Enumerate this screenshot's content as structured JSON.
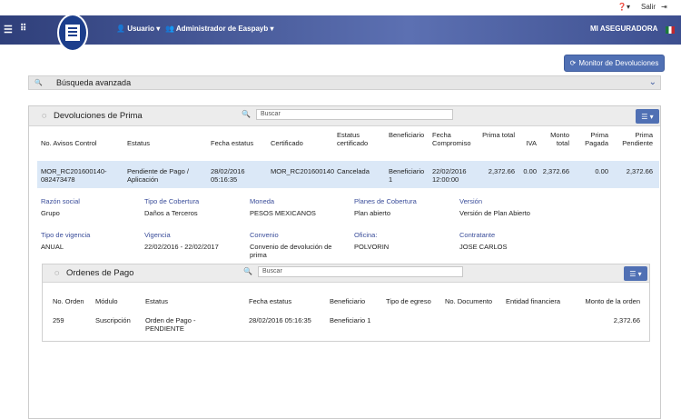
{
  "topbar": {
    "help_icon": "question-icon",
    "salir": "Salir"
  },
  "nav": {
    "usuario": "Usuario",
    "admin": "Administrador de Easpayb",
    "company": "MI ASEGURADORA"
  },
  "monitor_button": "Monitor de Devoluciones",
  "busqueda": "Búsqueda avanzada",
  "panel": {
    "title": "Devoluciones de Prima",
    "search_placeholder": "Buscar"
  },
  "table": {
    "headers": [
      "No. Avisos Control",
      "Estatus",
      "Fecha estatus",
      "Certificado",
      "Estatus certificado",
      "Beneficiario",
      "Fecha Compromiso",
      "Prima total",
      "IVA",
      "Monto total",
      "Prima Pagada",
      "Prima Pendiente"
    ],
    "row": [
      "MOR_RC201600140-082473478",
      "Pendiente de Pago / Aplicación",
      "28/02/2016 05:16:35",
      "MOR_RC201600140",
      "Cancelada",
      "Beneficiario 1",
      "22/02/2016 12:00:00",
      "2,372.66",
      "0.00",
      "2,372.66",
      "0.00",
      "2,372.66"
    ]
  },
  "details": [
    {
      "label": "Razón social",
      "value": "Grupo"
    },
    {
      "label": "Tipo de Cobertura",
      "value": "Daños a Terceros"
    },
    {
      "label": "Moneda",
      "value": "PESOS MEXICANOS"
    },
    {
      "label": "Planes de Cobertura",
      "value": "Plan abierto"
    },
    {
      "label": "Versión",
      "value": "Versión de Plan Abierto"
    },
    {
      "label": "Tipo de vigencia",
      "value": "ANUAL"
    },
    {
      "label": "Vigencia",
      "value": "22/02/2016 - 22/02/2017"
    },
    {
      "label": "Convenio",
      "value": "Convenio de devolución de prima"
    },
    {
      "label": "Oficina:",
      "value": "POLVORIN"
    },
    {
      "label": "Contratante",
      "value": "JOSE CARLOS"
    }
  ],
  "ordenes": {
    "title": "Ordenes de Pago",
    "search_placeholder": "Buscar",
    "headers": [
      "No. Orden",
      "Módulo",
      "Estatus",
      "Fecha estatus",
      "Beneficiario",
      "Tipo de egreso",
      "No. Documento",
      "Entidad financiera",
      "Monto de la orden"
    ],
    "row": [
      "259",
      "Suscripción",
      "Orden de Pago - PENDIENTE",
      "28/02/2016 05:16:35",
      "Beneficiario 1",
      "",
      "",
      "",
      "2,372.66"
    ]
  }
}
